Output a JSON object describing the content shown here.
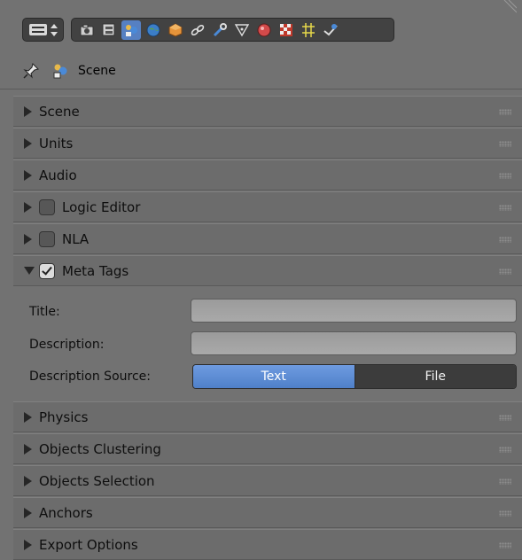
{
  "context": {
    "scene_name": "Scene"
  },
  "toolbar": {
    "icons": [
      "render-icon",
      "render-layers-icon",
      "scene-icon",
      "world-icon",
      "object-icon",
      "constraints-icon",
      "modifiers-icon",
      "data-icon",
      "material-icon",
      "texture-icon",
      "particles-icon",
      "physics-icon"
    ],
    "active": "scene-icon"
  },
  "panels": [
    {
      "label": "Scene",
      "expanded": false
    },
    {
      "label": "Units",
      "expanded": false
    },
    {
      "label": "Audio",
      "expanded": false
    },
    {
      "label": "Logic Editor",
      "expanded": false,
      "checkbox": false
    },
    {
      "label": "NLA",
      "expanded": false,
      "checkbox": false
    },
    {
      "label": "Meta Tags",
      "expanded": true,
      "checkbox": true
    },
    {
      "label": "Physics",
      "expanded": false
    },
    {
      "label": "Objects Clustering",
      "expanded": false
    },
    {
      "label": "Objects Selection",
      "expanded": false
    },
    {
      "label": "Anchors",
      "expanded": false
    },
    {
      "label": "Export Options",
      "expanded": false
    }
  ],
  "meta_tags": {
    "title_label": "Title:",
    "title_value": "",
    "description_label": "Description:",
    "description_value": "",
    "source_label": "Description Source:",
    "source_options": [
      "Text",
      "File"
    ],
    "source_selected": "Text"
  },
  "colors": {
    "background": "#727272",
    "accent": "#5680c2"
  }
}
